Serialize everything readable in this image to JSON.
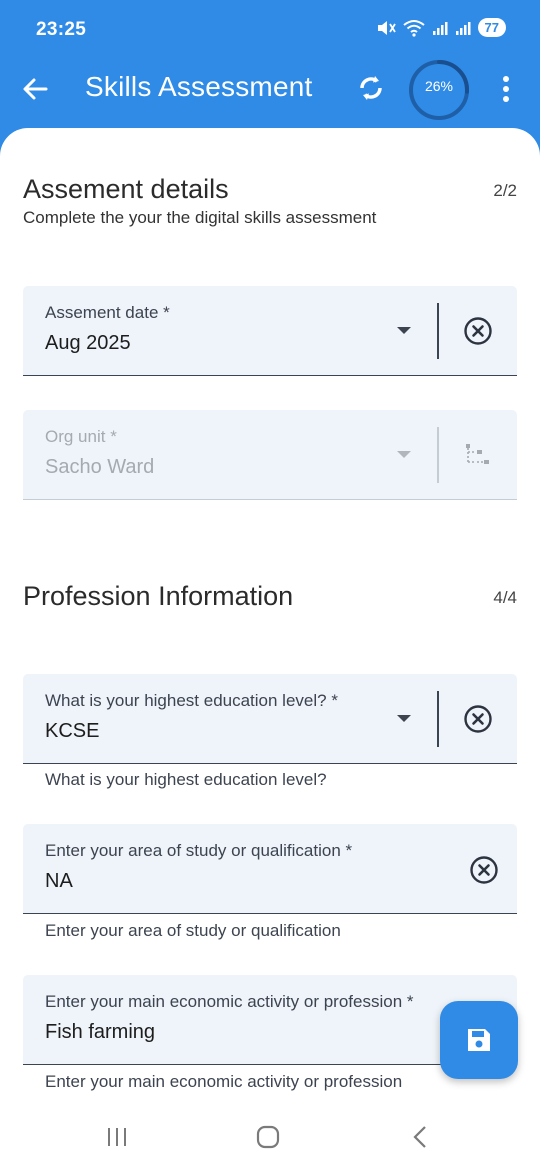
{
  "status_bar": {
    "time": "23:25",
    "battery": "77"
  },
  "app_bar": {
    "title": "Skills Assessment",
    "progress": "26%",
    "progress_fraction": 0.26
  },
  "sections": [
    {
      "title": "Assement details",
      "subtitle": "Complete the your the digital skills assessment",
      "count": "2/2"
    },
    {
      "title": "Profession Information",
      "count": "4/4"
    }
  ],
  "fields": {
    "assessment_date": {
      "label": "Assement date *",
      "value": "Aug 2025"
    },
    "org_unit": {
      "label": "Org unit *",
      "value": "Sacho Ward"
    },
    "education_level": {
      "label": "What is your highest education level? *",
      "value": "KCSE",
      "helper": "What is your highest education level?"
    },
    "area_of_study": {
      "label": "Enter your area of study or qualification *",
      "value": "NA",
      "helper": "Enter your area of study or qualification"
    },
    "economic_activity": {
      "label": "Enter your main economic activity or profession *",
      "value": "Fish farming",
      "helper": "Enter your main economic activity or profession"
    }
  },
  "icons": {
    "back": "arrow-left-icon",
    "sync": "sync-icon",
    "more": "more-vert-icon",
    "clear": "clear-circle-icon",
    "org_tree": "org-tree-icon",
    "save": "save-icon"
  },
  "colors": {
    "primary": "#2f8be6",
    "field_bg": "#eef4f9"
  }
}
